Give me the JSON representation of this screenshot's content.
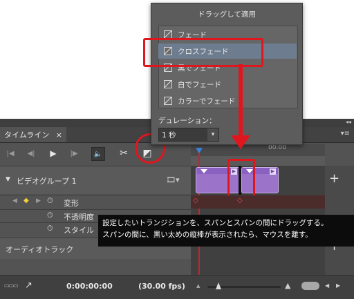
{
  "panel": {
    "tab_title": "タイムライン",
    "tab_close": "×",
    "collapse": "◂◂",
    "panel_menu": "▾≡"
  },
  "controls": {
    "first": "|◀",
    "prev": "◀|",
    "play": "▶",
    "next": "|▶",
    "audio": "🔈",
    "split": "✂",
    "transition": "◩"
  },
  "tracks": {
    "video_group": "ビデオグループ 1",
    "film": "🎞▾",
    "add": "+",
    "transform": "変形",
    "opacity": "不透明度",
    "style": "スタイル",
    "audio_track": "オーディオトラック",
    "audio_add": "+",
    "stopwatch": "⏱"
  },
  "ruler": {
    "time_label": "00:00"
  },
  "menu": {
    "title": "ドラッグして適用",
    "items": [
      "フェード",
      "クロスフェード",
      "黒でフェード",
      "白でフェード",
      "カラーでフェード"
    ],
    "selected_index": 1,
    "duration_label": "デュレーション：",
    "duration_value": "1 秒",
    "duration_arrow": "▾"
  },
  "tooltip": {
    "line1": "設定したいトランジションを、スパンとスパンの間にドラッグする。",
    "line2": "スパンの間に、黒い太めの縦棒が表示されたら、マウスを離す。"
  },
  "bottom": {
    "timecode": "0:00:00:00",
    "fps": "(30.00 fps)",
    "left_icon": "▭▭▭",
    "share": "↗",
    "zoom_out": "▲",
    "zoom_in": "▲"
  },
  "colors": {
    "highlight": "#e0161f",
    "clip": "#9b73c9",
    "menu_selected": "#6d7c8f"
  }
}
